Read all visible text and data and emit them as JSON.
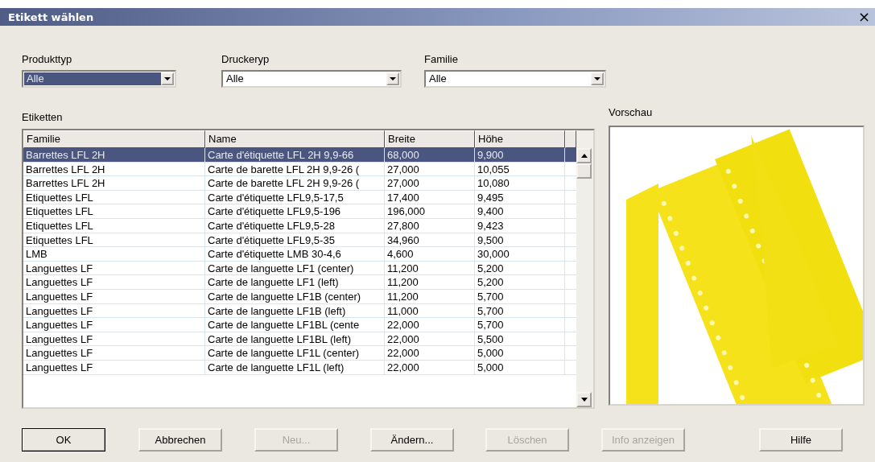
{
  "window": {
    "title": "Etikett wählen",
    "close": "×"
  },
  "filters": [
    {
      "label": "Produkttyp",
      "value": "Alle",
      "focused": true
    },
    {
      "label": "Druckeryp",
      "value": "Alle",
      "focused": false
    },
    {
      "label": "Familie",
      "value": "Alle",
      "focused": false
    }
  ],
  "table": {
    "label": "Etiketten",
    "columns": [
      "Familie",
      "Name",
      "Breite",
      "Höhe"
    ],
    "rows": [
      {
        "cells": [
          "Barrettes LFL 2H",
          "Carte d'étiquette LFL 2H 9,9-66",
          "68,000",
          "9,900"
        ],
        "selected": true
      },
      {
        "cells": [
          "Barrettes LFL 2H",
          "Carte de barette LFL 2H 9,9-26 (",
          "27,000",
          "10,055"
        ],
        "selected": false
      },
      {
        "cells": [
          "Barrettes LFL 2H",
          "Carte de barette LFL 2H 9,9-26 (",
          "27,000",
          "10,080"
        ],
        "selected": false
      },
      {
        "cells": [
          "Etiquettes LFL",
          "Carte d'étiquette LFL9,5-17,5",
          "17,400",
          "9,495"
        ],
        "selected": false
      },
      {
        "cells": [
          "Etiquettes LFL",
          "Carte d'étiquette LFL9,5-196",
          "196,000",
          "9,400"
        ],
        "selected": false
      },
      {
        "cells": [
          "Etiquettes LFL",
          "Carte d'étiquette LFL9,5-28",
          "27,800",
          "9,423"
        ],
        "selected": false
      },
      {
        "cells": [
          "Etiquettes LFL",
          "Carte d'étiquette LFL9,5-35",
          "34,960",
          "9,500"
        ],
        "selected": false
      },
      {
        "cells": [
          "LMB",
          "Carte d'étiquette LMB 30-4,6",
          "4,600",
          "30,000"
        ],
        "selected": false
      },
      {
        "cells": [
          "Languettes LF",
          "Carte de languette LF1 (center)",
          "11,200",
          "5,200"
        ],
        "selected": false
      },
      {
        "cells": [
          "Languettes LF",
          "Carte de languette LF1 (left)",
          "11,200",
          "5,200"
        ],
        "selected": false
      },
      {
        "cells": [
          "Languettes LF",
          "Carte de languette LF1B (center)",
          "11,200",
          "5,700"
        ],
        "selected": false
      },
      {
        "cells": [
          "Languettes LF",
          "Carte de languette LF1B (left)",
          "11,000",
          "5,700"
        ],
        "selected": false
      },
      {
        "cells": [
          "Languettes LF",
          "Carte de languette LF1BL (cente",
          "22,000",
          "5,700"
        ],
        "selected": false
      },
      {
        "cells": [
          "Languettes LF",
          "Carte de languette LF1BL (left)",
          "22,000",
          "5,500"
        ],
        "selected": false
      },
      {
        "cells": [
          "Languettes LF",
          "Carte de languette LF1L (center)",
          "22,000",
          "5,000"
        ],
        "selected": false
      },
      {
        "cells": [
          "Languettes LF",
          "Carte de languette LF1L (left)",
          "22,000",
          "5,000"
        ],
        "selected": false
      }
    ]
  },
  "preview": {
    "label": "Vorschau"
  },
  "buttons": [
    {
      "label": "OK",
      "default": true,
      "disabled": false
    },
    {
      "label": "Abbrechen",
      "default": false,
      "disabled": false
    },
    {
      "label": "Neu...",
      "default": false,
      "disabled": true
    },
    {
      "label": "Ändern...",
      "default": false,
      "disabled": false
    },
    {
      "label": "Löschen",
      "default": false,
      "disabled": true
    },
    {
      "label": "Info anzeigen",
      "default": false,
      "disabled": true
    },
    {
      "label": "Hilfe",
      "default": false,
      "disabled": false
    }
  ]
}
